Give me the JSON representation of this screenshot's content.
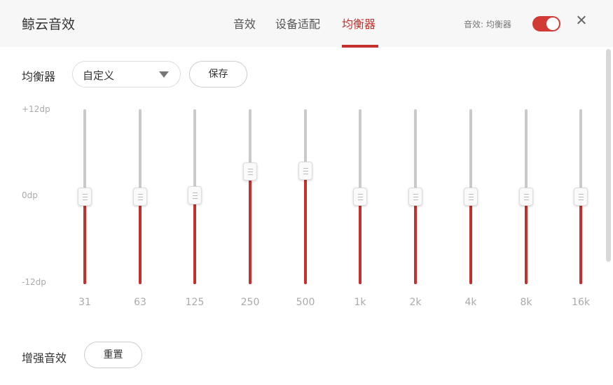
{
  "header": {
    "app_title": "鲸云音效",
    "tabs": [
      {
        "label": "音效",
        "active": false
      },
      {
        "label": "设备适配",
        "active": false
      },
      {
        "label": "均衡器",
        "active": true
      }
    ],
    "toggle_label": "音效: 均衡器",
    "toggle_on": true
  },
  "equalizer": {
    "section_label": "均衡器",
    "preset_value": "自定义",
    "save_label": "保存",
    "db_max": "+12dp",
    "db_mid": "0dp",
    "db_min": "-12dp",
    "bands": [
      {
        "label": "31",
        "gain_db": 0
      },
      {
        "label": "63",
        "gain_db": 0
      },
      {
        "label": "125",
        "gain_db": 0.2
      },
      {
        "label": "250",
        "gain_db": 3.5
      },
      {
        "label": "500",
        "gain_db": 3.6
      },
      {
        "label": "1k",
        "gain_db": 0
      },
      {
        "label": "2k",
        "gain_db": 0
      },
      {
        "label": "4k",
        "gain_db": 0
      },
      {
        "label": "8k",
        "gain_db": 0
      },
      {
        "label": "16k",
        "gain_db": 0
      }
    ]
  },
  "enhance": {
    "section_label": "增强音效",
    "reset_label": "重置"
  },
  "colors": {
    "accent": "#c3302e",
    "track": "#cacaca",
    "header_bg": "#f7f7f7"
  }
}
